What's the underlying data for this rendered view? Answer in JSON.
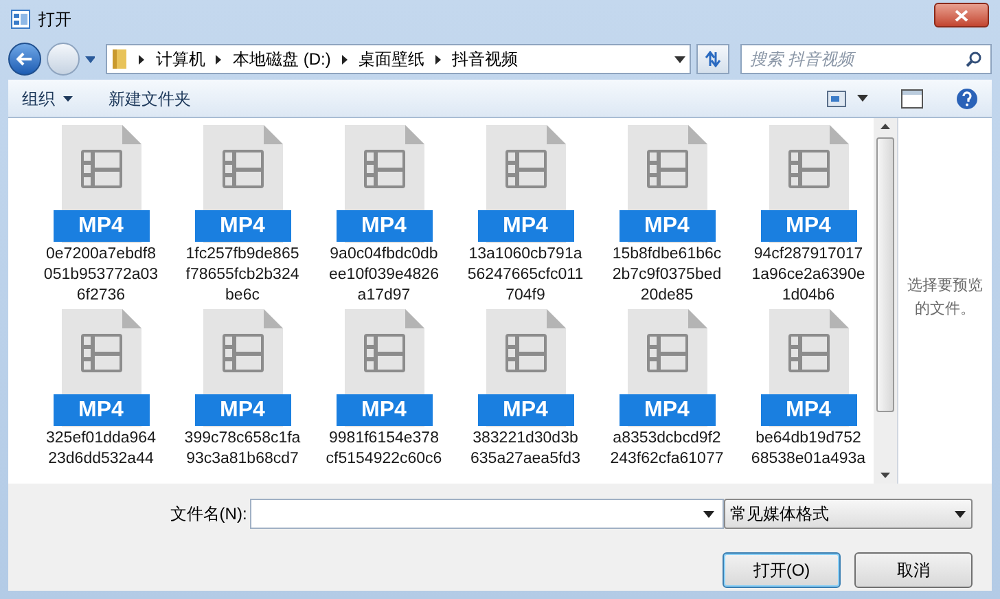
{
  "window": {
    "title": "打开"
  },
  "address": {
    "crumbs": [
      "计算机",
      "本地磁盘 (D:)",
      "桌面壁纸",
      "抖音视频"
    ]
  },
  "search": {
    "placeholder": "搜索 抖音视频"
  },
  "toolbar": [
    {
      "label": "组织",
      "dropdown": true
    },
    {
      "label": "新建文件夹",
      "dropdown": false
    }
  ],
  "files": [
    {
      "badge": "MP4",
      "name_lines": [
        "0e7200a7ebdf8",
        "051b953772a03",
        "6f2736"
      ]
    },
    {
      "badge": "MP4",
      "name_lines": [
        "1fc257fb9de865",
        "f78655fcb2b324",
        "be6c"
      ]
    },
    {
      "badge": "MP4",
      "name_lines": [
        "9a0c04fbdc0db",
        "ee10f039e4826",
        "a17d97"
      ]
    },
    {
      "badge": "MP4",
      "name_lines": [
        "13a1060cb791a",
        "56247665cfc011",
        "704f9"
      ]
    },
    {
      "badge": "MP4",
      "name_lines": [
        "15b8fdbe61b6c",
        "2b7c9f0375bed",
        "20de85"
      ]
    },
    {
      "badge": "MP4",
      "name_lines": [
        "94cf287917017",
        "1a96ce2a6390e",
        "1d04b6"
      ]
    },
    {
      "badge": "MP4",
      "name_lines": [
        "325ef01dda964",
        "23d6dd532a44"
      ]
    },
    {
      "badge": "MP4",
      "name_lines": [
        "399c78c658c1fa",
        "93c3a81b68cd7"
      ]
    },
    {
      "badge": "MP4",
      "name_lines": [
        "9981f6154e378",
        "cf5154922c60c6"
      ]
    },
    {
      "badge": "MP4",
      "name_lines": [
        "383221d30d3b",
        "635a27aea5fd3"
      ]
    },
    {
      "badge": "MP4",
      "name_lines": [
        "a8353dcbcd9f2",
        "243f62cfa61077"
      ]
    },
    {
      "badge": "MP4",
      "name_lines": [
        "be64db19d752",
        "68538e01a493a"
      ]
    }
  ],
  "preview_pane": {
    "message": "选择要预览的文件。"
  },
  "filename": {
    "label": "文件名(N):"
  },
  "file_type": {
    "value": "常见媒体格式"
  },
  "buttons": [
    "打开(O)",
    "取消"
  ]
}
